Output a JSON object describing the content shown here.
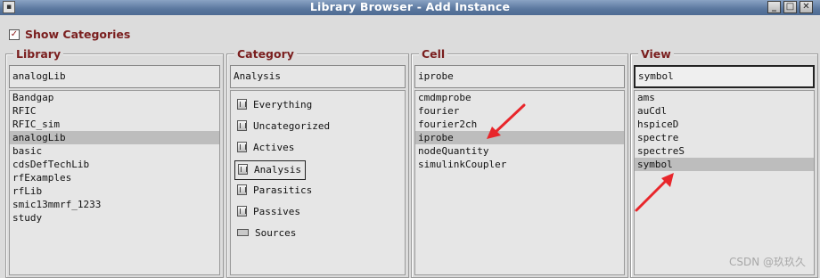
{
  "window": {
    "title": "Library Browser - Add Instance",
    "buttons": [
      "_",
      "□",
      "✕"
    ]
  },
  "show_categories": {
    "label": "Show Categories",
    "checked": true,
    "check_mark": "✓"
  },
  "library": {
    "label": "Library",
    "value": "analogLib",
    "items": [
      "Bandgap",
      "RFIC",
      "RFIC_sim",
      "analogLib",
      "basic",
      "cdsDefTechLib",
      "rfExamples",
      "rfLib",
      "smic13mmrf_1233",
      "study"
    ],
    "selected_index": 3
  },
  "category": {
    "label": "Category",
    "value": "Analysis",
    "items": [
      {
        "label": "Everything",
        "icon": "book-icon"
      },
      {
        "label": "Uncategorized",
        "icon": "book-icon"
      },
      {
        "label": "Actives",
        "icon": "book-icon"
      },
      {
        "label": "Analysis",
        "icon": "book-icon"
      },
      {
        "label": "Parasitics",
        "icon": "book-icon"
      },
      {
        "label": "Passives",
        "icon": "book-icon"
      },
      {
        "label": "Sources",
        "icon": "folder-flat-icon"
      }
    ],
    "selected_index": 3
  },
  "cell": {
    "label": "Cell",
    "value": "iprobe",
    "items": [
      "cmdmprobe",
      "fourier",
      "fourier2ch",
      "iprobe",
      "nodeQuantity",
      "simulinkCoupler"
    ],
    "selected_index": 3
  },
  "view": {
    "label": "View",
    "value": "symbol",
    "items": [
      "ams",
      "auCdl",
      "hspiceD",
      "spectre",
      "spectreS",
      "symbol"
    ],
    "selected_index": 5
  },
  "annotation_color": "#e8262b",
  "watermark": "CSDN @玖玖久"
}
